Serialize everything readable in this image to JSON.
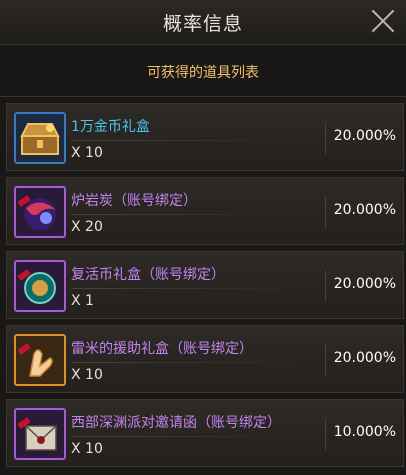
{
  "window": {
    "title": "概率信息"
  },
  "subtitle": "可获得的道具列表",
  "items": [
    {
      "name": "1万金币礼盒",
      "quantity": "X 10",
      "rate": "20.000%",
      "name_color": "blue",
      "icon": "gold-chest-icon",
      "frame": "gold"
    },
    {
      "name": "炉岩炭（账号绑定）",
      "quantity": "X 20",
      "rate": "20.000%",
      "name_color": "purple",
      "icon": "lava-stone-icon",
      "frame": "purple"
    },
    {
      "name": "复活币礼盒（账号绑定）",
      "quantity": "X 1",
      "rate": "20.000%",
      "name_color": "purple",
      "icon": "revive-coin-icon",
      "frame": "purple"
    },
    {
      "name": "雷米的援助礼盒（账号绑定）",
      "quantity": "X 10",
      "rate": "20.000%",
      "name_color": "purple",
      "icon": "remy-aid-box-icon",
      "frame": "orange"
    },
    {
      "name": "西部深渊派对邀请函（账号绑定）",
      "quantity": "X 10",
      "rate": "10.000%",
      "name_color": "purple",
      "icon": "abyss-invitation-icon",
      "frame": "purple"
    }
  ],
  "colors": {
    "background": "#1a1816",
    "subtitle": "#f0c070",
    "name_blue": "#4cc3e8",
    "name_purple": "#c184ef"
  }
}
